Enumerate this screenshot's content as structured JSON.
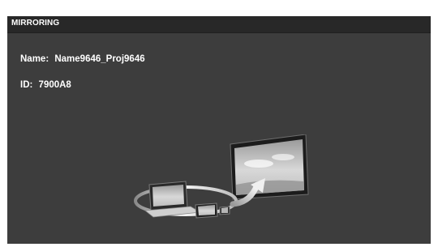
{
  "header": {
    "title": "MIRRORING"
  },
  "info": {
    "name_label": "Name:",
    "name_value": "Name9646_Proj9646",
    "id_label": "ID:",
    "id_value": "7900A8"
  },
  "illustration": {
    "icon": "mirroring-devices-to-display-icon"
  },
  "colors": {
    "background": "#3d3d3d",
    "title_bar": "#282828",
    "text": "#ffffff"
  }
}
